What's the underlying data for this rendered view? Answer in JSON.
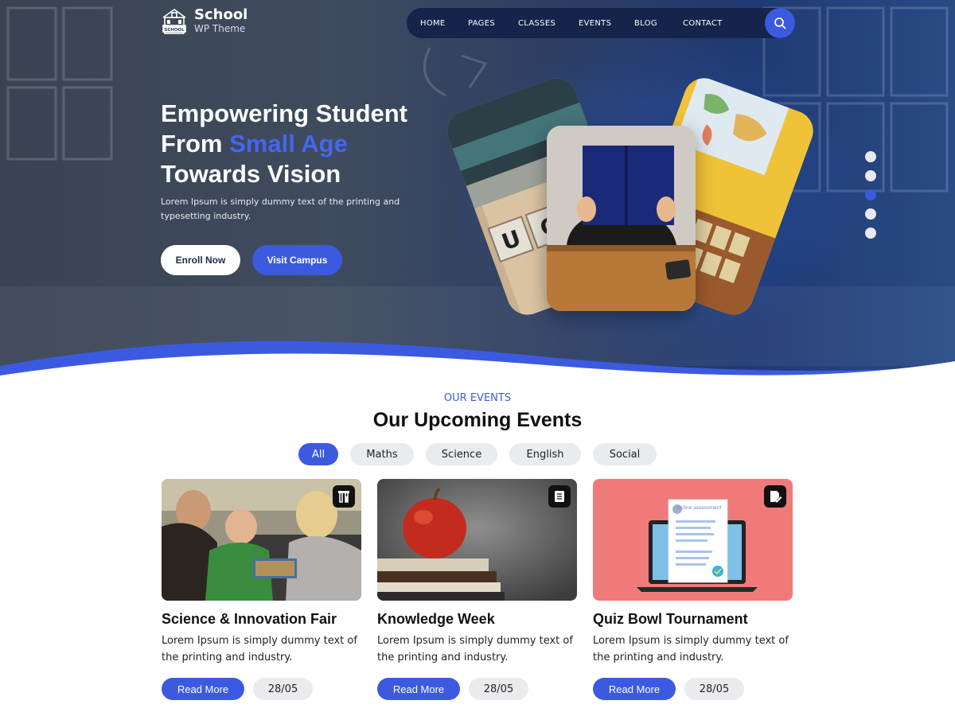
{
  "brand": {
    "title": "School",
    "subtitle": "WP Theme",
    "mark_text": "SCHOOL"
  },
  "nav": {
    "items": [
      "HOME",
      "PAGES",
      "CLASSES",
      "EVENTS",
      "BLOG",
      "CONTACT"
    ],
    "search_icon": "search-icon"
  },
  "hero": {
    "title_line1": "Empowering Student",
    "title_line2_plain": "From ",
    "title_line2_accent": "Small Age",
    "title_line3": "Towards Vision",
    "description": "Lorem Ipsum is simply dummy text of the printing and typesetting industry.",
    "primary_button": "Enroll Now",
    "secondary_button": "Visit Campus",
    "slider": {
      "count": 5,
      "active_index": 3
    }
  },
  "events": {
    "kicker": "OUR EVENTS",
    "title": "Our Upcoming Events",
    "filters": [
      "All",
      "Maths",
      "Science",
      "English",
      "Social"
    ],
    "active_filter": "All",
    "cards": [
      {
        "title": "Science & Innovation Fair",
        "description": "Lorem Ipsum is simply dummy text of the printing and  industry.",
        "button": "Read More",
        "date": "28/05",
        "icon": "flask-icon"
      },
      {
        "title": "Knowledge Week",
        "description": "Lorem Ipsum is simply dummy text of the printing and  industry.",
        "button": "Read More",
        "date": "28/05",
        "icon": "book-icon"
      },
      {
        "title": "Quiz Bowl Tournament",
        "description": "Lorem Ipsum is simply dummy text of the printing and  industry.",
        "button": "Read More",
        "date": "28/05",
        "icon": "edit-document-icon"
      }
    ],
    "quiz_image_text": "online assessment"
  },
  "colors": {
    "accent": "#3c5ae0",
    "nav_bg": "#16234a",
    "hero_bg": "#3f4b5e"
  }
}
